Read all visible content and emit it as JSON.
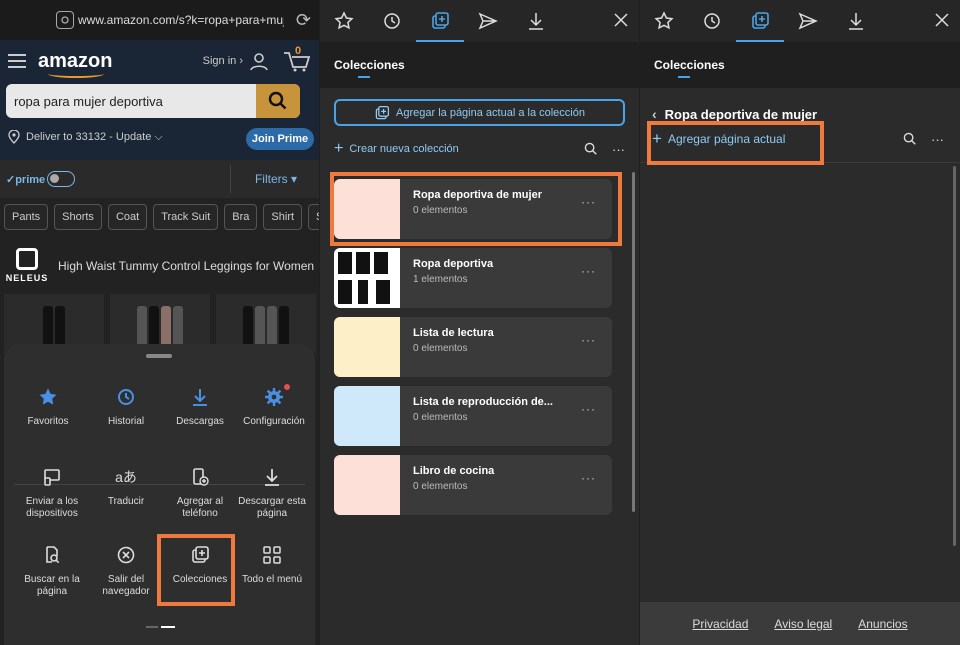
{
  "browser": {
    "url": "www.amazon.com/s?k=ropa+para+muj",
    "amazon": {
      "logo": "amazon",
      "sign_in": "Sign in ›",
      "cart_count": "0",
      "search_value": "ropa para mujer deportiva",
      "deliver": "Deliver to 33132 - Update ⌵",
      "join_prime": "Join Prime",
      "prime_label": "✓prime",
      "filters": "Filters ▾",
      "chips": [
        "Pants",
        "Shorts",
        "Coat",
        "Track Suit",
        "Bra",
        "Shirt",
        "Sw"
      ],
      "brand": "NELEUS",
      "product_title": "High Waist Tummy Control Leggings for Women"
    }
  },
  "menu": {
    "items": [
      {
        "label": "Favoritos",
        "icon": "star-icon"
      },
      {
        "label": "Historial",
        "icon": "history-icon"
      },
      {
        "label": "Descargas",
        "icon": "download-icon"
      },
      {
        "label": "Configuración",
        "icon": "gear-icon"
      },
      {
        "label": "Enviar a los dispositivos",
        "icon": "send-device-icon"
      },
      {
        "label": "Traducir",
        "icon": "translate-icon"
      },
      {
        "label": "Agregar al teléfono",
        "icon": "add-phone-icon"
      },
      {
        "label": "Descargar esta página",
        "icon": "download-page-icon"
      },
      {
        "label": "Buscar en la página",
        "icon": "find-page-icon"
      },
      {
        "label": "Salir del navegador",
        "icon": "exit-icon"
      },
      {
        "label": "Colecciones",
        "icon": "collections-icon"
      },
      {
        "label": "Todo el menú",
        "icon": "grid-icon"
      }
    ]
  },
  "collections": {
    "header": "Colecciones",
    "add_current": "Agregar la página actual a la colección",
    "new_collection": "Crear nueva colección",
    "items": [
      {
        "name": "Ropa deportiva de mujer",
        "count": "0 elementos",
        "color": "#fde0d8"
      },
      {
        "name": "Ropa deportiva",
        "count": "1 elementos",
        "color": "#ffffff"
      },
      {
        "name": "Lista de lectura",
        "count": "0 elementos",
        "color": "#fdf0c8"
      },
      {
        "name": "Lista de reproducción de...",
        "count": "0 elementos",
        "color": "#cfe9fb"
      },
      {
        "name": "Libro de cocina",
        "count": "0 elementos",
        "color": "#fde0d8"
      }
    ]
  },
  "detail": {
    "header": "Colecciones",
    "title": "Ropa deportiva de mujer",
    "add_page": "Agregar página actual",
    "footer": [
      "Privacidad",
      "Aviso legal",
      "Anuncios"
    ]
  },
  "colors": {
    "accent": "#4aa3e8",
    "highlight": "#f07a3d"
  }
}
